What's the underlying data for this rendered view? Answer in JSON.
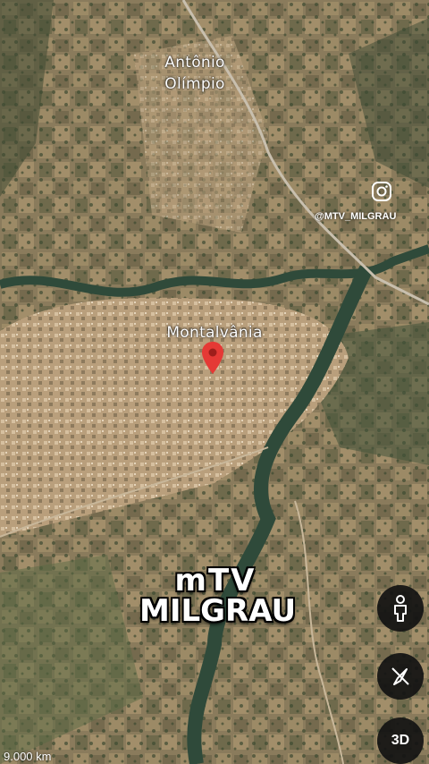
{
  "places": {
    "town_north_line1": "Antônio",
    "town_north_line2": "Olímpio",
    "town_main": "Montalvânia"
  },
  "watermark": {
    "handle": "@MTV_MILGRAU",
    "logo_line1": "mTV",
    "logo_line2": "MILGRAU"
  },
  "controls": {
    "street_view_icon": "person-icon",
    "compass_icon": "compass-icon",
    "view_3d_label": "3D"
  },
  "scale": {
    "label": "9.000 km"
  },
  "colors": {
    "pin": "#e53935",
    "river": "#2f4a3a",
    "fab": "#121212"
  }
}
